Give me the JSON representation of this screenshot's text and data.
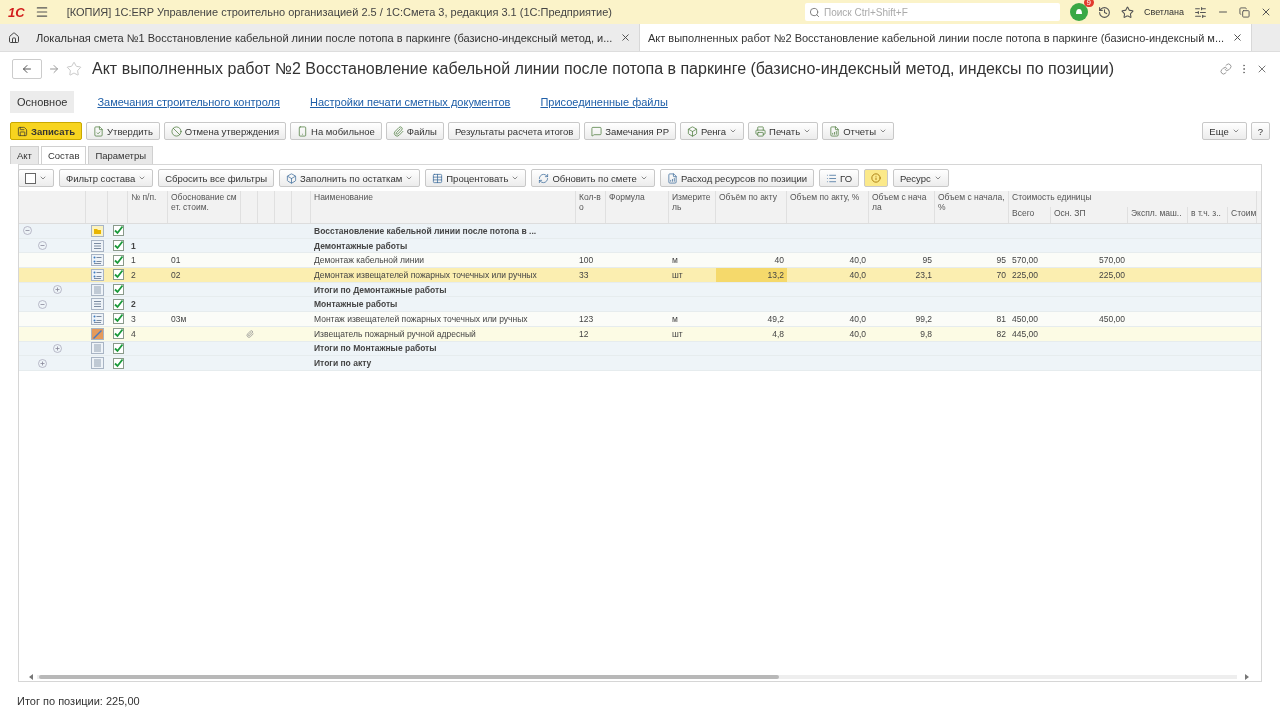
{
  "app_bar": {
    "logo": "1С",
    "title": "[КОПИЯ] 1С:ERP Управление строительно организацией 2.5 / 1С:Смета 3, редакция 3.1  (1С:Предприятие)",
    "search_placeholder": "Поиск Ctrl+Shift+F",
    "notification_count": "9",
    "user": "Светлана"
  },
  "tabs": [
    {
      "label": "Локальная смета №1 Восстановление кабельной линии после потопа в паркинге (базисно-индексный метод, и...",
      "selected": false
    },
    {
      "label": "Акт выполненных работ №2 Восстановление кабельной линии после потопа в паркинге (базисно-индексный м...",
      "selected": true
    }
  ],
  "form": {
    "title": "Акт выполненных работ №2 Восстановление кабельной линии после потопа в паркинге (базисно-индексный метод, индексы по позиции)",
    "sections": [
      {
        "label": "Основное",
        "selected": true
      },
      {
        "label": "Замечания строительного контроля",
        "selected": false
      },
      {
        "label": "Настройки печати сметных документов",
        "selected": false
      },
      {
        "label": "Присоединенные файлы",
        "selected": false
      }
    ]
  },
  "toolbar": [
    {
      "label": "Записать",
      "kind": "primary",
      "dropdown": false
    },
    {
      "label": "Утвердить",
      "kind": "normal",
      "dropdown": false
    },
    {
      "label": "Отмена утверждения",
      "kind": "normal",
      "dropdown": false
    },
    {
      "label": "На мобильное",
      "kind": "normal",
      "dropdown": false
    },
    {
      "label": "Файлы",
      "kind": "normal",
      "dropdown": false
    },
    {
      "label": "Результаты расчета итогов",
      "kind": "normal",
      "dropdown": false
    },
    {
      "label": "Замечания РР",
      "kind": "normal",
      "dropdown": false
    },
    {
      "label": "Ренга",
      "kind": "normal",
      "dropdown": true
    },
    {
      "label": "Печать",
      "kind": "normal",
      "dropdown": true
    },
    {
      "label": "Отчеты",
      "kind": "normal",
      "dropdown": true
    }
  ],
  "toolbar_right": [
    {
      "label": "Еще",
      "dropdown": true
    },
    {
      "label": "?",
      "dropdown": false
    }
  ],
  "subtabs": [
    {
      "label": "Акт",
      "selected": false
    },
    {
      "label": "Состав",
      "selected": true
    },
    {
      "label": "Параметры",
      "selected": false
    }
  ],
  "table_toolbar": [
    {
      "label": "Фильтр состава",
      "dropdown": true
    },
    {
      "label": "Сбросить все фильтры",
      "dropdown": false
    },
    {
      "label": "Заполнить по остаткам",
      "dropdown": true
    },
    {
      "label": "Процентовать",
      "dropdown": true
    },
    {
      "label": "Обновить по смете",
      "dropdown": true
    },
    {
      "label": "Расход ресурсов по позиции",
      "dropdown": false
    },
    {
      "label": "ГО",
      "dropdown": false
    },
    {
      "label": "Ресурс",
      "dropdown": true
    }
  ],
  "table": {
    "columns": [
      "№ п/п.",
      "Обоснование смет. стоим.",
      "Наименование",
      "Кол-во",
      "Формула",
      "Измеритель",
      "Объём по акту",
      "Объем по акту, %",
      "Объем с начала",
      "Объем с начала, %"
    ],
    "column_group": {
      "label": "Стоимость единицы",
      "columns": [
        "Всего",
        "Осн. ЗП",
        "Экспл. маш..",
        "в т.ч. з..",
        "Стоим"
      ]
    },
    "rows": [
      {
        "kind": "section",
        "checked": true,
        "expanded": true,
        "selected": false,
        "name": "Восстановление кабельной линии после потопа в ...",
        "children": [
          {
            "kind": "group",
            "checked": true,
            "expanded": true,
            "selected": false,
            "number": "1",
            "name": "Демонтажные работы",
            "children": [
              {
                "kind": "item",
                "checked": true,
                "selected": false,
                "number": "1",
                "basis": "01",
                "name": "Демонтаж кабельной линии",
                "qty": "100",
                "unit": "м",
                "vol_act": "40",
                "vol_act_pct": "40,0",
                "vol_start": "95",
                "vol_start_pct": "95",
                "total": "570,00",
                "base_wage": "570,00"
              },
              {
                "kind": "item",
                "checked": true,
                "selected": true,
                "vol_act_focused": true,
                "number": "2",
                "basis": "02",
                "name": "Демонтаж извещателей пожарных точечных или ручных",
                "qty": "33",
                "unit": "шт",
                "vol_act": "13,2",
                "vol_act_pct": "40,0",
                "vol_start": "23,1",
                "vol_start_pct": "70",
                "total": "225,00",
                "base_wage": "225,00"
              },
              {
                "kind": "total",
                "checked": true,
                "expanded": false,
                "selected": false,
                "name": "Итоги по Демонтажные работы"
              }
            ]
          },
          {
            "kind": "group",
            "checked": true,
            "expanded": true,
            "selected": false,
            "number": "2",
            "name": "Монтажные работы",
            "children": [
              {
                "kind": "item",
                "checked": true,
                "selected": false,
                "number": "3",
                "basis": "03м",
                "name": "Монтаж извещателей пожарных точечных или ручных",
                "qty": "123",
                "unit": "м",
                "vol_act": "49,2",
                "vol_act_pct": "40,0",
                "vol_start": "99,2",
                "vol_start_pct": "81",
                "total": "450,00",
                "base_wage": "450,00"
              },
              {
                "kind": "resource",
                "checked": true,
                "selected": false,
                "attachment": true,
                "number": "4",
                "name": "Извещатель пожарный ручной адресный",
                "qty": "12",
                "unit": "шт",
                "vol_act": "4,8",
                "vol_act_pct": "40,0",
                "vol_start": "9,8",
                "vol_start_pct": "82",
                "total": "445,00"
              },
              {
                "kind": "total",
                "checked": true,
                "expanded": false,
                "selected": false,
                "name": "Итоги по Монтажные работы"
              }
            ]
          },
          {
            "kind": "total",
            "checked": true,
            "expanded": false,
            "selected": false,
            "name": "Итоги по акту"
          }
        ]
      }
    ]
  },
  "footer": "Итог по позиции: 225,00"
}
